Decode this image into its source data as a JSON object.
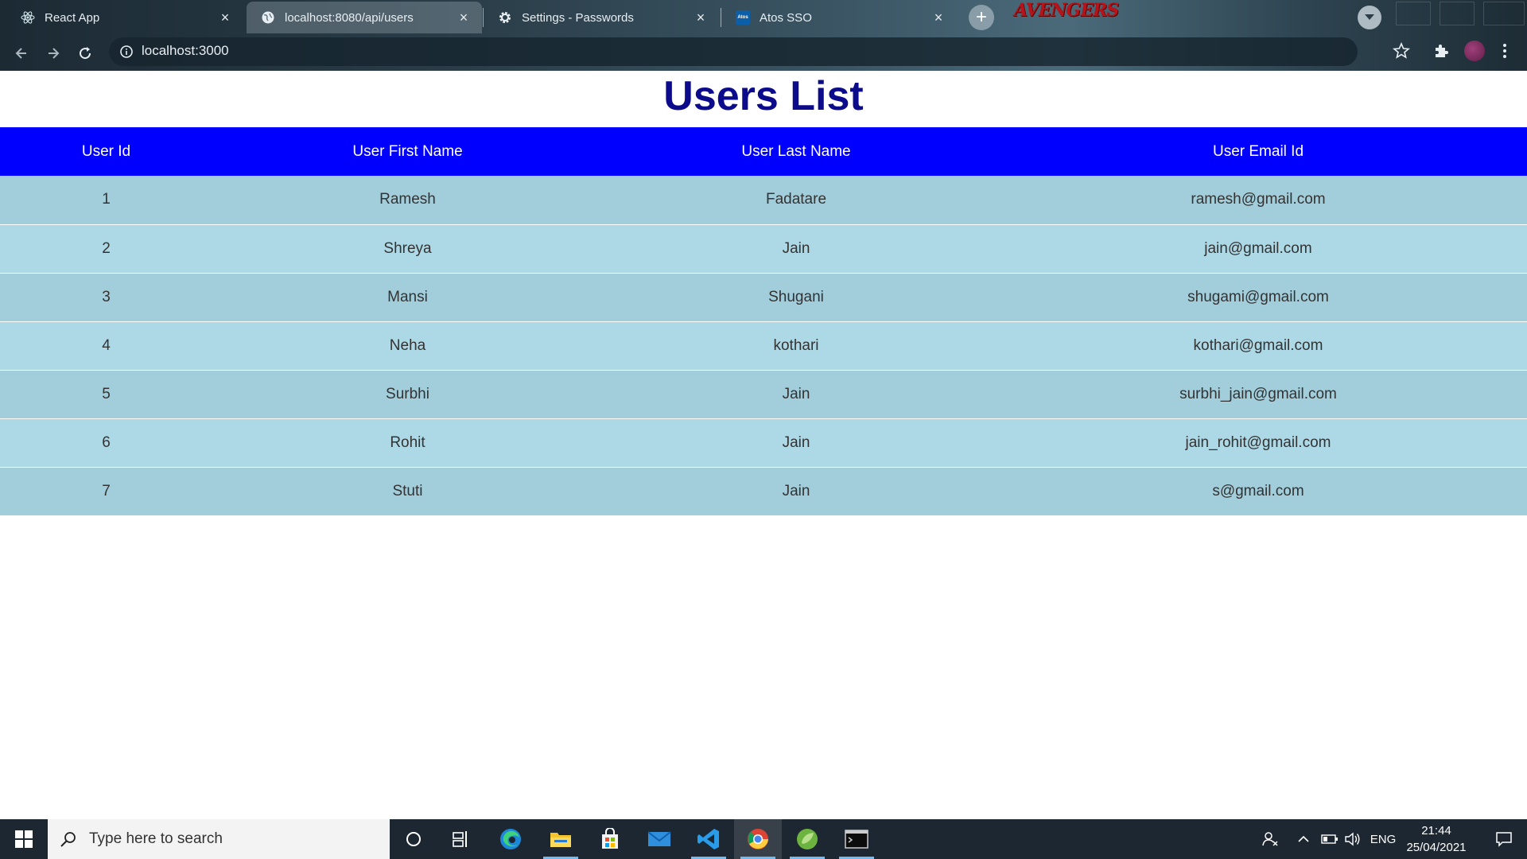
{
  "browser": {
    "tabs": [
      {
        "title": "React App",
        "icon": "react-icon",
        "active": true
      },
      {
        "title": "localhost:8080/api/users",
        "icon": "globe-icon",
        "active": false
      },
      {
        "title": "Settings - Passwords",
        "icon": "gear-icon",
        "active": false
      },
      {
        "title": "Atos SSO",
        "icon": "atos-icon",
        "active": false
      }
    ],
    "theme_logo_text": "AVENGERS",
    "url": "localhost:3000"
  },
  "page": {
    "title": "Users List",
    "table": {
      "headers": [
        "User Id",
        "User First Name",
        "User Last Name",
        "User Email Id"
      ],
      "rows": [
        [
          "1",
          "Ramesh",
          "Fadatare",
          "ramesh@gmail.com"
        ],
        [
          "2",
          "Shreya",
          "Jain",
          "jain@gmail.com"
        ],
        [
          "3",
          "Mansi",
          "Shugani",
          "shugami@gmail.com"
        ],
        [
          "4",
          "Neha",
          "kothari",
          "kothari@gmail.com"
        ],
        [
          "5",
          "Surbhi",
          "Jain",
          "surbhi_jain@gmail.com"
        ],
        [
          "6",
          "Rohit",
          "Jain",
          "jain_rohit@gmail.com"
        ],
        [
          "7",
          "Stuti",
          "Jain",
          "s@gmail.com"
        ]
      ]
    },
    "colors": {
      "title": "#0b0b8c",
      "header_bg": "#0000ff",
      "row_odd": "#a2cddb",
      "row_even": "#add8e6"
    }
  },
  "taskbar": {
    "search_placeholder": "Type here to search",
    "apps": [
      "cortana-icon",
      "task-view-icon",
      "edge-icon",
      "file-explorer-icon",
      "store-icon",
      "mail-icon",
      "vscode-icon",
      "chrome-icon",
      "spring-tool-icon",
      "terminal-icon"
    ],
    "language": "ENG",
    "time": "21:44",
    "date": "25/04/2021"
  }
}
